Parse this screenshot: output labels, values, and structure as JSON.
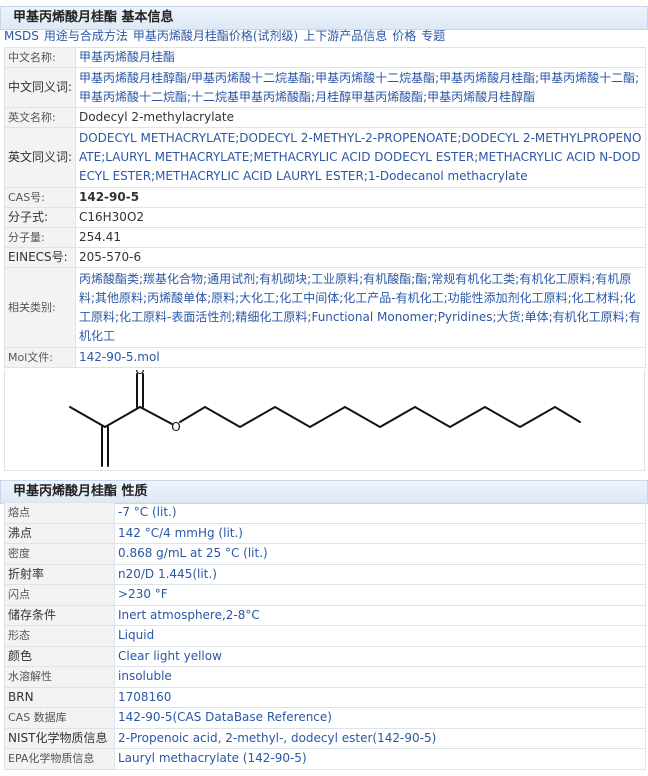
{
  "basic": {
    "title": "甲基丙烯酸月桂酯 基本信息",
    "links": [
      "MSDS",
      "用途与合成方法",
      "甲基丙烯酸月桂酯价格(试剂级)",
      "上下游产品信息",
      "价格",
      "专题"
    ],
    "cn_name_label": "中文名称:",
    "cn_name": "甲基丙烯酸月桂酯",
    "cn_syn_label": "中文同义词:",
    "cn_syn": "甲基丙烯酸月桂醇酯/甲基丙烯酸十二烷基酯;甲基丙烯酸十二烷基酯;甲基丙烯酸月桂酯;甲基丙烯酸十二酯;甲基丙烯酸十二烷酯;十二烷基甲基丙烯酸酯;月桂醇甲基丙烯酸酯;甲基丙烯酸月桂醇酯",
    "en_name_label": "英文名称:",
    "en_name": "Dodecyl 2-methylacrylate",
    "en_syn_label": "英文同义词:",
    "en_syn": "DODECYL METHACRYLATE;DODECYL 2-METHYL-2-PROPENOATE;DODECYL 2-METHYLPROPENOATE;LAURYL METHACRYLATE;METHACRYLIC ACID DODECYL ESTER;METHACRYLIC ACID N-DODECYL ESTER;METHACRYLIC ACID LAURYL ESTER;1-Dodecanol methacrylate",
    "cas_label": "CAS号:",
    "cas": "142-90-5",
    "formula_label": "分子式:",
    "formula": "C16H30O2",
    "mw_label": "分子量:",
    "mw": "254.41",
    "einecs_label": "EINECS号:",
    "einecs": "205-570-6",
    "category_label": "相关类别:",
    "category": "丙烯酸酯类;羰基化合物;通用试剂;有机砌块;工业原料;有机酸酯;酯;常规有机化工类;有机化工原料;有机原料;其他原料;丙烯酸单体;原料;大化工;化工中间体;化工产品-有机化工;功能性添加剂化工原料;化工材料;化工原料;化工原料-表面活性剂;精细化工原料;Functional Monomer;Pyridines;大货;单体;有机化工原料;有机化工",
    "mol_label": "Mol文件:",
    "mol": "142-90-5.mol",
    "struct_o_top": "O",
    "struct_o_ester": "O"
  },
  "props": {
    "title": "甲基丙烯酸月桂酯 性质",
    "rows": [
      {
        "label": "熔点",
        "value": "-7 °C (lit.)",
        "size": "small"
      },
      {
        "label": "沸点",
        "value": "142 °C/4 mmHg (lit.)",
        "size": "big"
      },
      {
        "label": "密度",
        "value": "0.868 g/mL at 25 °C (lit.)",
        "size": "small"
      },
      {
        "label": "折射率",
        "value": "n20/D 1.445(lit.)",
        "size": "big"
      },
      {
        "label": "闪点",
        "value": ">230 °F",
        "size": "small"
      },
      {
        "label": "储存条件",
        "value": "Inert atmosphere,2-8°C",
        "size": "big"
      },
      {
        "label": "形态",
        "value": "Liquid",
        "size": "small"
      },
      {
        "label": "颜色",
        "value": "Clear light yellow",
        "size": "big"
      },
      {
        "label": "水溶解性",
        "value": "insoluble",
        "size": "small"
      },
      {
        "label": "BRN",
        "value": "1708160",
        "size": "big"
      },
      {
        "label": "CAS 数据库",
        "value": "142-90-5(CAS DataBase Reference)",
        "size": "small"
      },
      {
        "label": "NIST化学物质信息",
        "value": "2-Propenoic acid, 2-methyl-, dodecyl ester(142-90-5)",
        "size": "big"
      },
      {
        "label": "EPA化学物质信息",
        "value": "Lauryl methacrylate (142-90-5)",
        "size": "small"
      }
    ]
  }
}
